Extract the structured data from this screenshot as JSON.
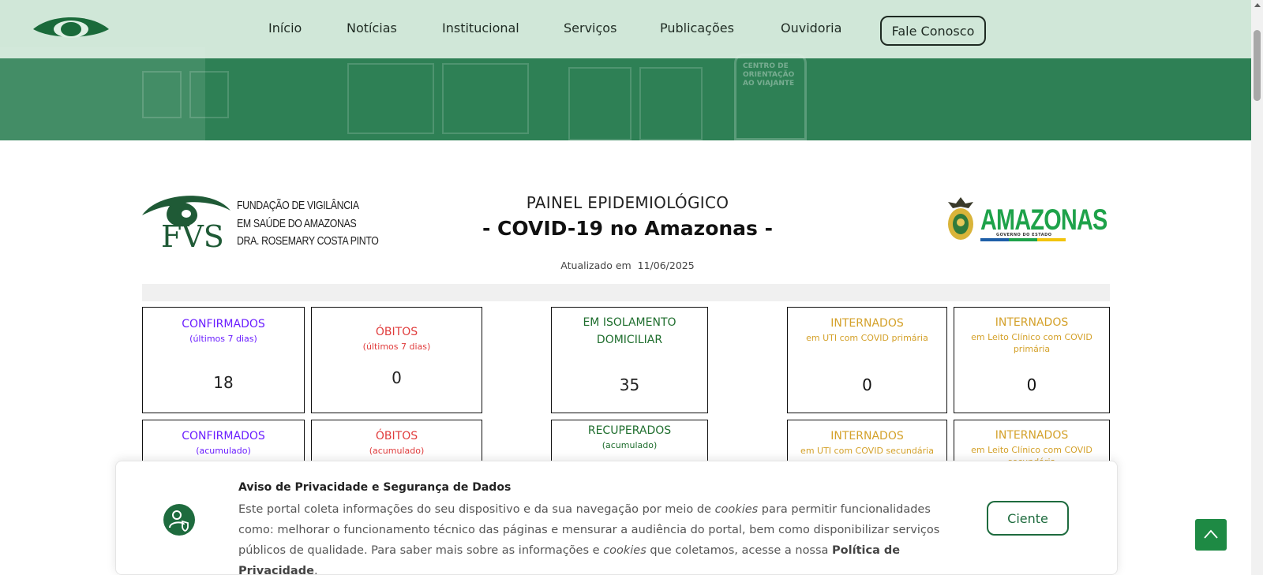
{
  "nav": {
    "links": [
      "Início",
      "Notícias",
      "Institucional",
      "Serviços",
      "Publicações",
      "Ouvidoria"
    ],
    "cta": "Fale Conosco"
  },
  "hero": {
    "sign_text": "CENTRO DE ORIENTAÇÃO AO VIAJANTE"
  },
  "header": {
    "org_lines": [
      "FUNDAÇÃO DE VIGILÂNCIA",
      "EM SAÚDE DO AMAZONAS",
      "DRA. ROSEMARY COSTA PINTO"
    ],
    "logo_initials": "FVS",
    "title": "PAINEL EPIDEMIOLÓGICO",
    "subtitle": "- COVID-19 no Amazonas -",
    "updated_label": "Atualizado em",
    "updated_date": "11/06/2025",
    "gov_name": "AMAZONAS",
    "gov_sub": "GOVERNO DO ESTADO"
  },
  "cards": {
    "confirmados7": {
      "title": "CONFIRMADOS",
      "sub": "(últimos 7 dias)",
      "value": "18"
    },
    "obitos7": {
      "title": "ÓBITOS",
      "sub": "(últimos 7 dias)",
      "value": "0"
    },
    "isolamento": {
      "title_1": "EM ISOLAMENTO",
      "title_2": "DOMICILIAR",
      "value": "35"
    },
    "uti_primaria": {
      "title": "INTERNADOS",
      "sub": "em UTI com COVID primária",
      "value": "0"
    },
    "leito_primaria": {
      "title": "INTERNADOS",
      "sub": "em Leito Clínico com COVID primária",
      "value": "0"
    },
    "confirmados_acum": {
      "title": "CONFIRMADOS",
      "sub": "(acumulado)"
    },
    "obitos_acum": {
      "title": "ÓBITOS",
      "sub": "(acumulado)"
    },
    "recuperados": {
      "title": "RECUPERADOS",
      "sub": "(acumulado)"
    },
    "uti_secundaria": {
      "title": "INTERNADOS",
      "sub": "em UTI com COVID secundária"
    },
    "leito_secundaria": {
      "title": "INTERNADOS",
      "sub": "em Leito Clínico com COVID secundária"
    }
  },
  "privacy": {
    "title": "Aviso de Privacidade e Segurança de Dados",
    "body_1": "Este portal coleta informações do seu dispositivo e da sua navegação por meio de ",
    "cookies": "cookies",
    "body_2": " para permitir funcionalidades como: melhorar o funcionamento técnico das páginas e mensurar a audiência do portal, bem como disponibilizar serviços públicos de qualidade. Para saber mais sobre as informações e ",
    "body_3": " que coletamos, acesse a nossa ",
    "policy_link": "Política de Privacidade",
    "body_end": ".",
    "button": "Ciente"
  },
  "colors": {
    "brand_green": "#1e6b3e",
    "hero_green": "#2e8055",
    "confirmados": "#6a1dff",
    "obitos": "#e03c3c",
    "isolamento": "#1f6e2e",
    "internados": "#d4a12a"
  },
  "icons": [
    "eye-logo-icon",
    "fvs-eye-icon",
    "amazonas-crest-icon",
    "privacy-user-shield-icon",
    "chevron-up-icon"
  ]
}
